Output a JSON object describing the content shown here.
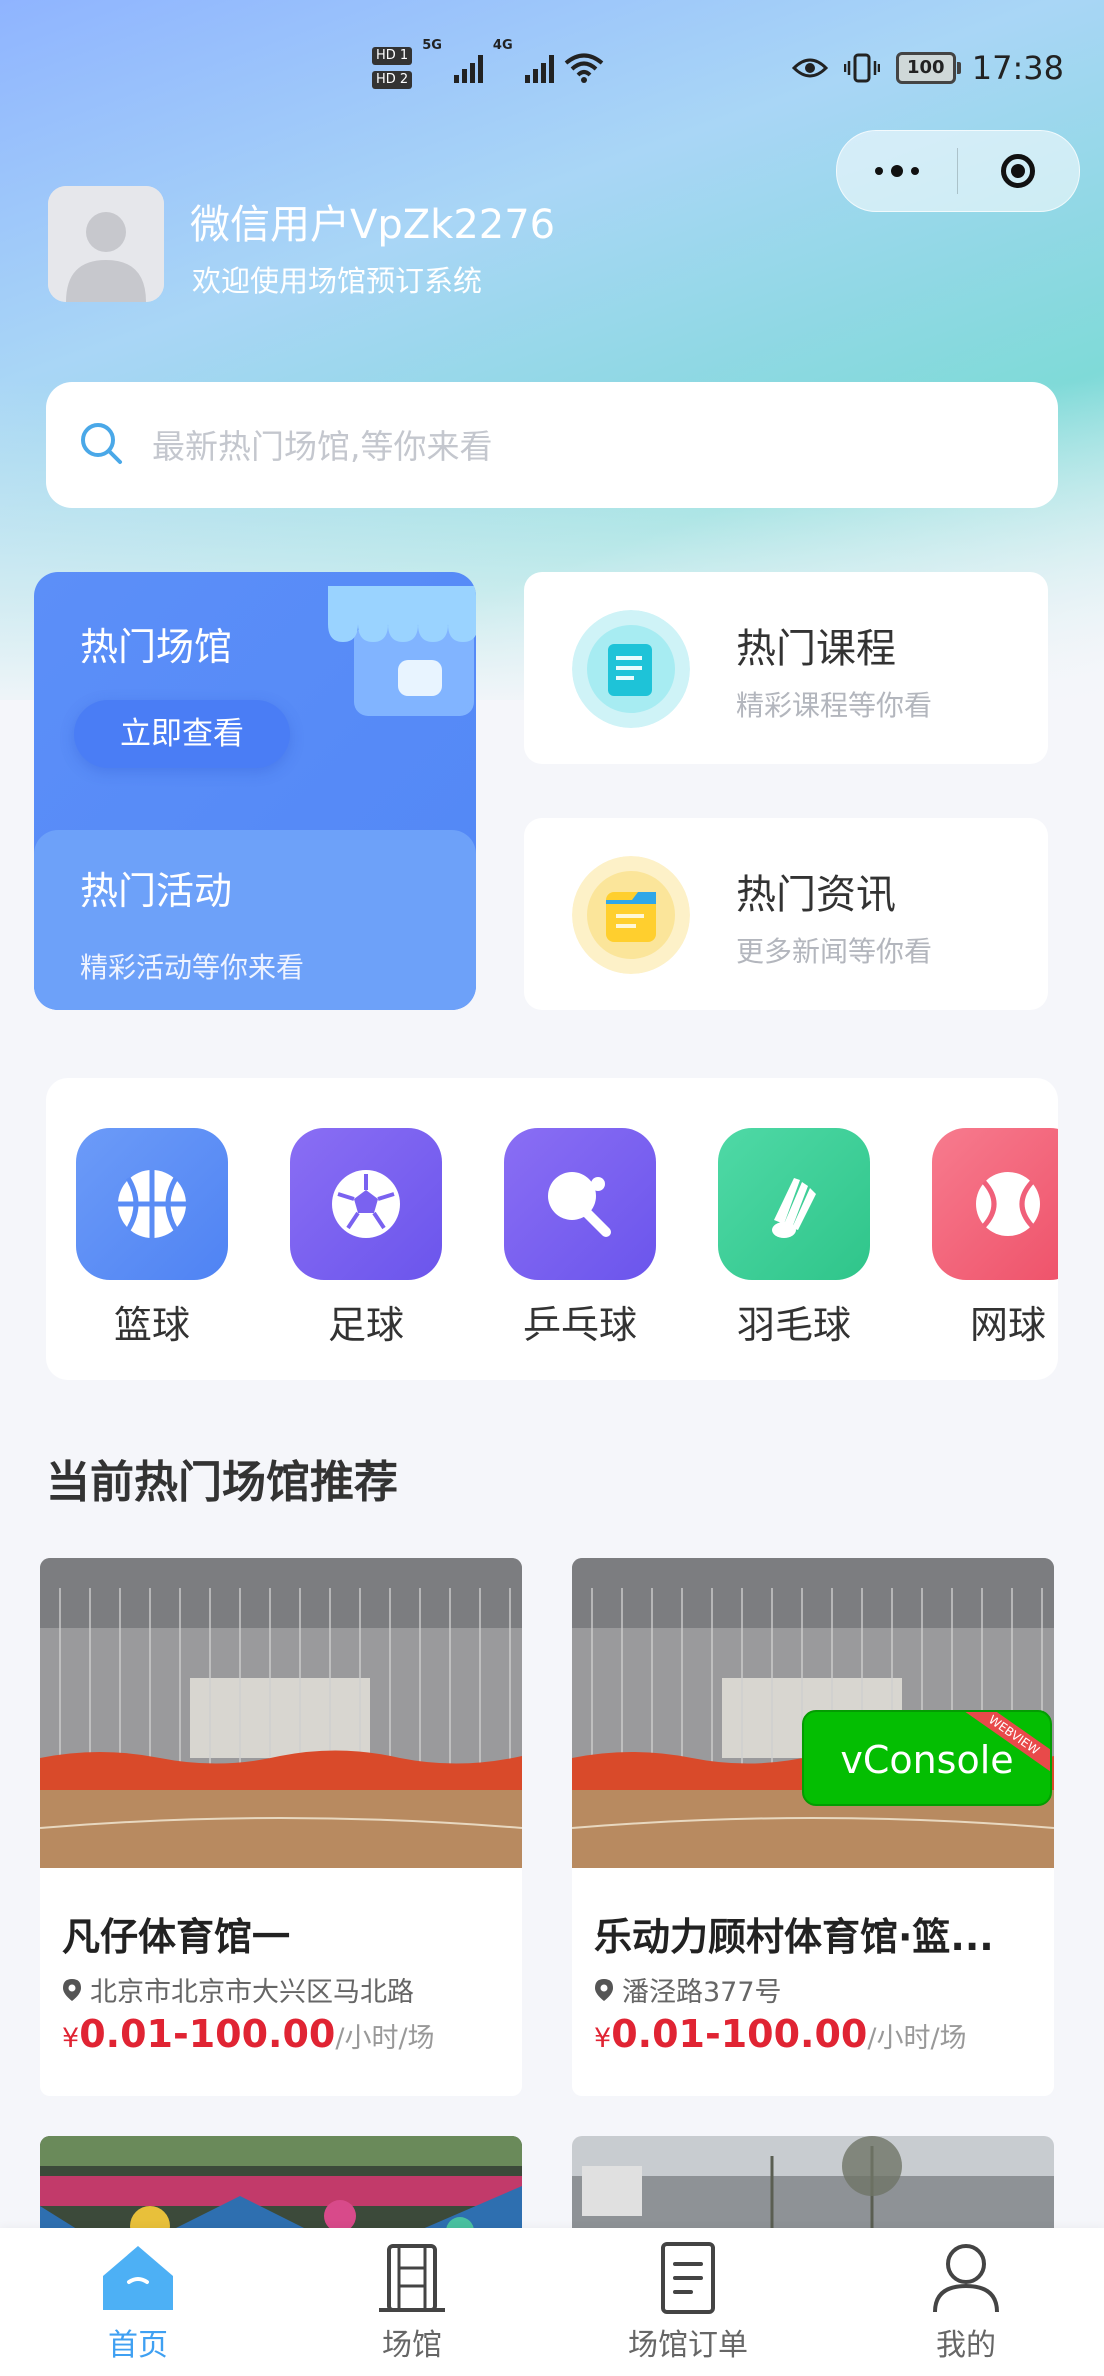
{
  "status_bar": {
    "hd1": "HD 1",
    "hd2": "HD 2",
    "net1": "5G",
    "net2": "4G",
    "battery": "100",
    "time": "17:38"
  },
  "user": {
    "name": "微信用户VpZk2276",
    "welcome": "欢迎使用场馆预订系统"
  },
  "search": {
    "placeholder": "最新热门场馆,等你来看"
  },
  "cards": {
    "hot_venue": {
      "title": "热门场馆",
      "button": "立即查看"
    },
    "hot_activity": {
      "title": "热门活动",
      "subtitle": "精彩活动等你来看"
    },
    "hot_course": {
      "title": "热门课程",
      "subtitle": "精彩课程等你看"
    },
    "hot_news": {
      "title": "热门资讯",
      "subtitle": "更多新闻等你看"
    }
  },
  "sports": [
    {
      "label": "篮球",
      "icon": "basketball-icon",
      "color": "#5b8ef6"
    },
    {
      "label": "足球",
      "icon": "soccer-icon",
      "color": "#7b63f0"
    },
    {
      "label": "乒乓球",
      "icon": "ping-pong-icon",
      "color": "#7b63f0"
    },
    {
      "label": "羽毛球",
      "icon": "badminton-icon",
      "color": "#3ccf95"
    },
    {
      "label": "网球",
      "icon": "tennis-icon",
      "color": "#f2607a"
    }
  ],
  "section": {
    "title": "当前热门场馆推荐"
  },
  "venues": [
    {
      "name": "凡仔体育馆一",
      "address": "北京市北京市大兴区马北路",
      "currency": "¥",
      "price": "0.01-100.00",
      "unit": "/小时/场"
    },
    {
      "name": "乐动力顾村体育馆·篮...",
      "address": "潘泾路377号",
      "currency": "¥",
      "price": "0.01-100.00",
      "unit": "/小时/场"
    }
  ],
  "vconsole": {
    "label": "vConsole",
    "ribbon": "WEBVIEW"
  },
  "tabbar": [
    {
      "label": "首页",
      "icon": "home-icon",
      "active": true
    },
    {
      "label": "场馆",
      "icon": "building-icon",
      "active": false
    },
    {
      "label": "场馆订单",
      "icon": "order-icon",
      "active": false
    },
    {
      "label": "我的",
      "icon": "user-icon",
      "active": false
    }
  ],
  "colors": {
    "accent": "#3fa0f2",
    "price": "#e02433",
    "card_blue": "#5c8ff8"
  }
}
